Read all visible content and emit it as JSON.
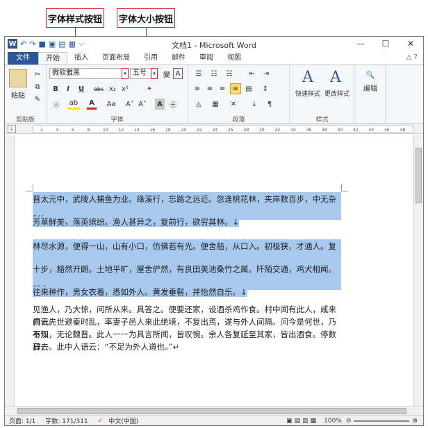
{
  "callouts": {
    "font_button": "字体样式按钮",
    "size_button": "字体大小按钮"
  },
  "window": {
    "title": "文档1 - Microsoft Word",
    "quick_access": [
      "W",
      "↶",
      "↷",
      "■",
      "▣",
      "▤",
      "▦",
      "⌵"
    ],
    "minimize": "—",
    "restore": "☐",
    "close": "✕"
  },
  "tabs": {
    "file": "文件",
    "home": "开始",
    "insert": "插入",
    "layout": "页面布局",
    "references": "引用",
    "mailings": "邮件",
    "review": "审阅",
    "view": "视图",
    "help_icons": "△ ?"
  },
  "ribbon": {
    "clipboard": {
      "paste": "粘贴",
      "label": "剪贴板"
    },
    "font": {
      "name": "微软雅黑",
      "size": "五号",
      "label": "字体",
      "bold": "B",
      "italic": "I",
      "underline": "U",
      "strike": "abc",
      "sub": "x₂",
      "sup": "x²",
      "grow": "A˄",
      "shrink": "A˅",
      "aa": "Aa",
      "color": "A",
      "highlight": "ab"
    },
    "paragraph": {
      "label": "段落"
    },
    "styles": {
      "quick": "快速样式",
      "change": "更改样式",
      "label": "样式"
    },
    "editing": {
      "label": "编辑"
    }
  },
  "ruler": {
    "marks": [
      "2",
      "4",
      "6",
      "8",
      "10",
      "12",
      "14",
      "16",
      "18",
      "20",
      "22",
      "24",
      "26",
      "28",
      "30",
      "32",
      "34",
      "36",
      "38",
      "40",
      "42",
      "44",
      "46",
      "48"
    ]
  },
  "document": {
    "highlighted": [
      "晋太元中，武陵人捕鱼为业。缘溪行，忘路之远近。忽逢桃花林，夹岸数百步，中无杂树，",
      "芳草鲜美，落英缤纷。渔人甚异之，复前行，欲穷其林。↓",
      "林尽水源，便得一山，山有小口，仿佛若有光。便舍船，从口入。初极狭，才通人。复行数",
      "十步，豁然开朗。土地平旷，屋舍俨然，有良田美池桑竹之属。阡陌交通，鸡犬相闻。其中",
      "往来种作，男女衣着，悉如外人。黄发垂髫，并怡然自乐。↓"
    ],
    "plain": [
      "见渔人，乃大惊，问所从来。具答之。便要还家，设酒杀鸡作食。村中闻有此人，咸来问讯。",
      "自云先世避秦时乱，率妻子邑人来此绝境，不复出焉，遂与外人间隔。问今是何世，乃不知",
      "有汉，无论魏晋。此人一一为具言所闻，皆叹惋。余人各复延至其家，皆出酒食。停数日，",
      "辞去。此中人语云：“不足为外人道也。”↵"
    ]
  },
  "statusbar": {
    "page": "页面: 1/1",
    "words": "字数: 171/311",
    "language": "中文(中国)",
    "zoom": "100%"
  }
}
